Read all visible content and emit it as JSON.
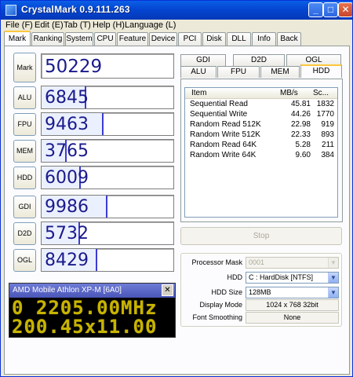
{
  "window": {
    "title": "CrystalMark 0.9.111.263"
  },
  "menu": [
    "File (F)",
    "Edit (E)",
    "Tab (T)",
    "Help (H)",
    "Language (L)"
  ],
  "tabs": [
    "Mark",
    "Ranking",
    "System",
    "CPU",
    "Feature",
    "Device",
    "PCI",
    "Disk",
    "DLL",
    "Info",
    "Back"
  ],
  "active_tab": "Mark",
  "scores": [
    {
      "label": "Mark",
      "value": "50229",
      "level": 0.0
    },
    {
      "label": "ALU",
      "value": "6845",
      "level": 0.34
    },
    {
      "label": "FPU",
      "value": "9463",
      "level": 0.47
    },
    {
      "label": "MEM",
      "value": "3765",
      "level": 0.19
    },
    {
      "label": "HDD",
      "value": "6009",
      "level": 0.3
    },
    {
      "label": "GDI",
      "value": "9986",
      "level": 0.5
    },
    {
      "label": "D2D",
      "value": "5732",
      "level": 0.29
    },
    {
      "label": "OGL",
      "value": "8429",
      "level": 0.42
    }
  ],
  "cpu_panel": {
    "title": "AMD Mobile Athlon XP-M [6A0]",
    "line1": "0 2205.00MHz",
    "line2": "200.45x11.00",
    "accent": "#c8b400"
  },
  "subtabs_top": [
    "GDI",
    "D2D",
    "OGL"
  ],
  "subtabs_bottom": [
    "ALU",
    "FPU",
    "MEM",
    "HDD"
  ],
  "active_subtab": "HDD",
  "results": {
    "columns": [
      "Item",
      "MB/s",
      "Sc..."
    ],
    "rows": [
      {
        "item": "Sequential Read",
        "mbs": "45.81",
        "score": "1832"
      },
      {
        "item": "Sequential Write",
        "mbs": "44.26",
        "score": "1770"
      },
      {
        "item": "Random Read 512K",
        "mbs": "22.98",
        "score": "919"
      },
      {
        "item": "Random Write 512K",
        "mbs": "22.33",
        "score": "893"
      },
      {
        "item": "Random Read 64K",
        "mbs": "5.28",
        "score": "211"
      },
      {
        "item": "Random Write 64K",
        "mbs": "9.60",
        "score": "384"
      }
    ]
  },
  "stop_button": "Stop",
  "settings": {
    "processor_mask_label": "Processor Mask",
    "processor_mask_value": "0001",
    "hdd_label": "HDD",
    "hdd_value": "C : HardDisk [NTFS]",
    "hdd_size_label": "HDD Size",
    "hdd_size_value": "128MB",
    "display_mode_label": "Display Mode",
    "display_mode_value": "1024 x 768 32bit",
    "font_smoothing_label": "Font Smoothing",
    "font_smoothing_value": "None"
  },
  "colors": {
    "title_bar": "#0546d1",
    "score_text": "#1a1a8c",
    "score_bar": "#3c3cd2"
  }
}
